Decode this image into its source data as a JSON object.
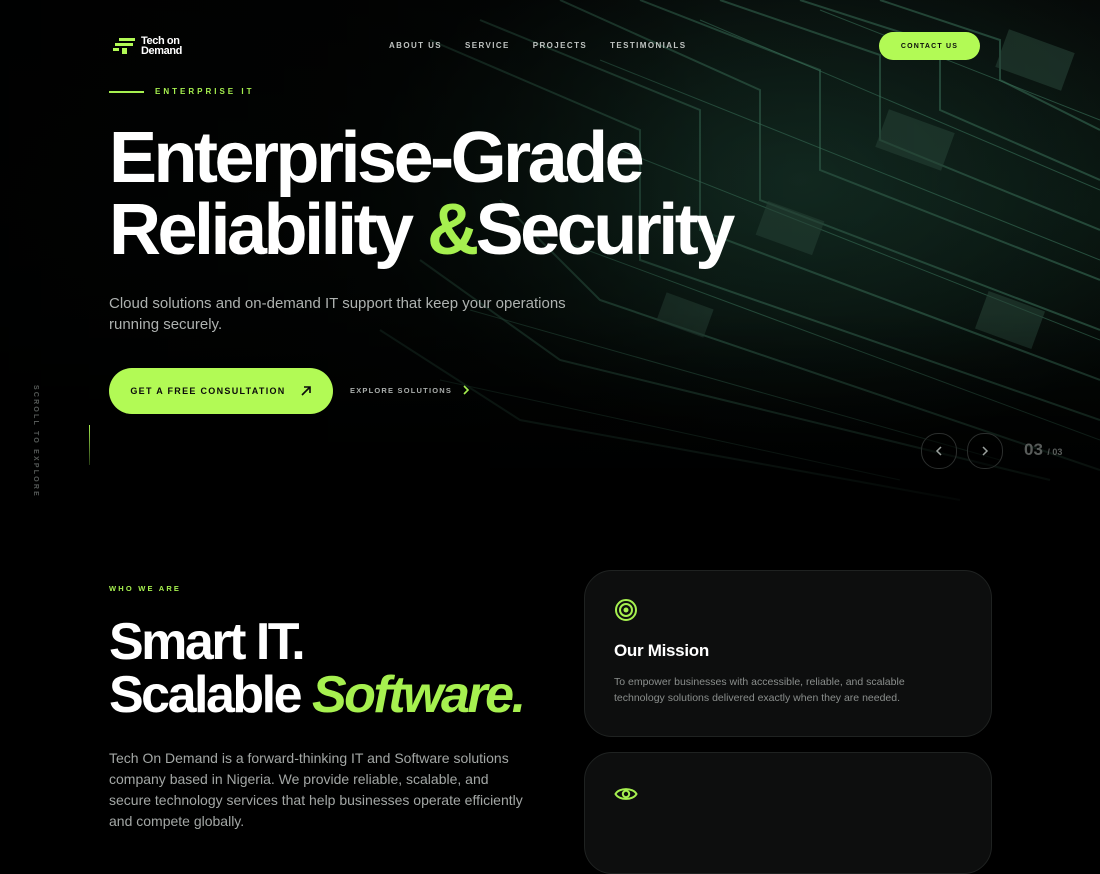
{
  "brand": {
    "logo_text_line1": "Tech on",
    "logo_text_line2": "Demand"
  },
  "nav": {
    "items": [
      "ABOUT US",
      "SERVICE",
      "PROJECTS",
      "TESTIMONIALS"
    ],
    "contact_label": "CONTACT US"
  },
  "hero": {
    "eyebrow": "ENTERPRISE IT",
    "title_line1": "Enterprise-Grade",
    "title_line2_a": "Reliability ",
    "title_amp": "&",
    "title_line2_b": "Security",
    "subtitle": "Cloud solutions and on-demand IT support that keep your operations running securely.",
    "cta_label": "GET A FREE CONSULTATION",
    "explore_label": "EXPLORE SOLUTIONS",
    "scroll_label": "SCROLL TO EXPLORE",
    "slide_current": "03",
    "slide_total": "/ 03"
  },
  "about": {
    "eyebrow": "WHO WE ARE",
    "title_line1": "Smart IT.",
    "title_line2_a": "Scalable ",
    "title_line2_accent": "Software.",
    "body": "Tech On Demand is a forward-thinking IT and Software solutions company based in Nigeria. We provide reliable, scalable, and secure technology services that help businesses operate efficiently and compete globally."
  },
  "cards": {
    "mission_title": "Our Mission",
    "mission_text": "To empower businesses with accessible, reliable, and scalable technology solutions delivered exactly when they are needed."
  },
  "colors": {
    "accent": "#b2fa55",
    "background": "#000000",
    "card": "#0d0e0e"
  }
}
